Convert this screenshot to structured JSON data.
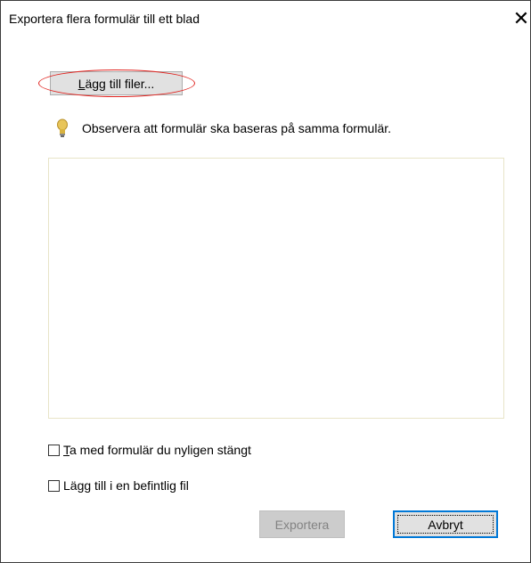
{
  "dialog": {
    "title": "Exportera flera formulär till ett blad",
    "close_glyph": "✕"
  },
  "add_files": {
    "label": "Lägg till filer...",
    "mnemonic": "L"
  },
  "hint": {
    "icon": "lightbulb-icon",
    "text": "Observera att formulär ska baseras på samma formulär."
  },
  "file_list": {
    "items": []
  },
  "options": {
    "include_recent": {
      "label": "Ta med formulär du nyligen stängt",
      "mnemonic": "T",
      "checked": false
    },
    "append_existing": {
      "label": "Lägg till i en befintlig fil",
      "checked": false
    }
  },
  "buttons": {
    "export_label": "Exportera",
    "export_enabled": false,
    "cancel_label": "Avbryt"
  },
  "colors": {
    "highlight_ellipse": "#e0231f",
    "focus_border": "#0078d7",
    "list_border": "#e8e4c8",
    "bulb": "#d9b340"
  }
}
